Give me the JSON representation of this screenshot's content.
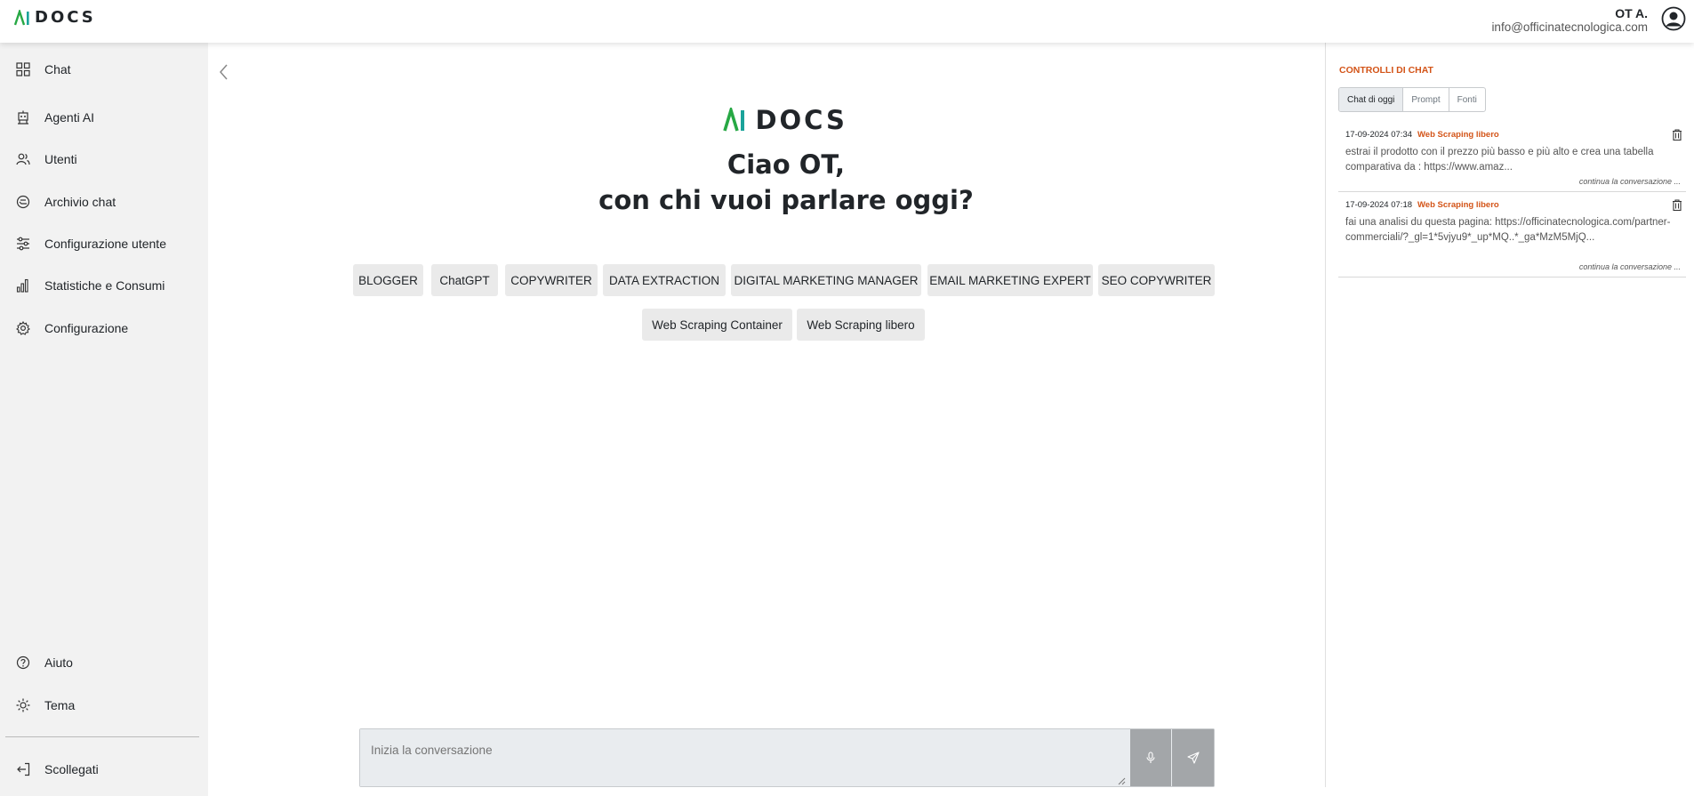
{
  "brand": {
    "name": "AIDOCS"
  },
  "user": {
    "name": "OT A.",
    "email": "info@officinatecnologica.com"
  },
  "sidebar": {
    "items": [
      {
        "label": "Chat",
        "icon": "grid-icon"
      },
      {
        "label": "Agenti AI",
        "icon": "robot-icon"
      },
      {
        "label": "Utenti",
        "icon": "users-icon"
      },
      {
        "label": "Archivio chat",
        "icon": "archive-icon"
      },
      {
        "label": "Configurazione utente",
        "icon": "sliders-icon"
      },
      {
        "label": "Statistiche e Consumi",
        "icon": "bar-chart-icon"
      },
      {
        "label": "Configurazione",
        "icon": "gear-icon"
      }
    ],
    "bottom_items": [
      {
        "label": "Aiuto",
        "icon": "help-icon"
      },
      {
        "label": "Tema",
        "icon": "sun-icon"
      }
    ],
    "logout": {
      "label": "Scollegati",
      "icon": "logout-icon"
    }
  },
  "main": {
    "greeting_line1": "Ciao OT,",
    "greeting_line2": "con chi vuoi parlare oggi?",
    "agents_row1": [
      "BLOGGER",
      "ChatGPT",
      "COPYWRITER",
      "DATA EXTRACTION",
      "DIGITAL MARKETING MANAGER",
      "EMAIL MARKETING EXPERT",
      "SEO COPYWRITER"
    ],
    "agents_row2": [
      "Web Scraping Container",
      "Web Scraping libero"
    ],
    "input_placeholder": "Inizia la conversazione"
  },
  "right_panel": {
    "title": "CONTROLLI DI CHAT",
    "tabs": [
      "Chat di oggi",
      "Prompt",
      "Fonti"
    ],
    "active_tab": "Chat di oggi",
    "conversations": [
      {
        "date": "17-09-2024 07:34",
        "agent": "Web Scraping libero",
        "text": "estrai il prodotto con il prezzo più basso e più alto e crea una tabella comparativa da : https://www.amaz...",
        "continue_label": "continua la conversazione ..."
      },
      {
        "date": "17-09-2024 07:18",
        "agent": "Web Scraping libero",
        "text": "fai una analisi du questa pagina: https://officinatecnologica.com/partner-commerciali/?_gl=1*5vjyu9*_up*MQ..*_ga*MzM5MjQ...",
        "continue_label": "continua la conversazione ..."
      }
    ]
  },
  "colors": {
    "accent": "#d35418",
    "logo_green": "#27a844",
    "logo_teal": "#1aa39a",
    "sidebar_bg": "#f2f2f2"
  }
}
